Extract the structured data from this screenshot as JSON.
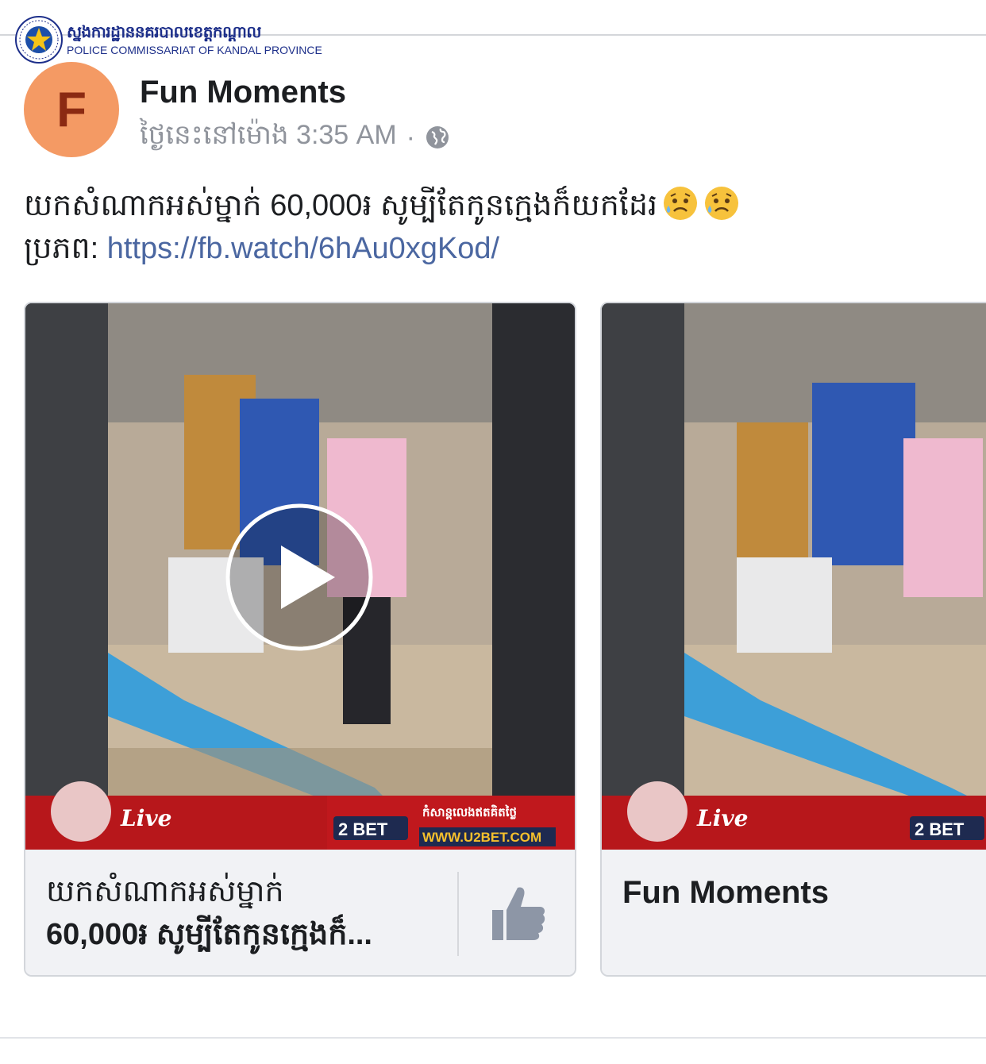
{
  "watermark": {
    "org_kh": "ស្នងការដ្ឋាននគរបាលខេត្តកណ្តាល",
    "org_en": "POLICE COMMISSARIAT OF KANDAL PROVINCE"
  },
  "post": {
    "avatar_letter": "F",
    "page_name": "Fun Moments",
    "time_text": "ថ្ងៃនេះនៅម៉ោង 3:35 AM",
    "separator": "·",
    "privacy_icon": "globe-icon",
    "body_line1": "យកសំណាកអស់ម្នាក់ 60,000៛ សូម្បីតែកូនក្មេងក៏យកដែរ",
    "emoji": [
      "sad-sweat-emoji",
      "sad-sweat-emoji"
    ],
    "source_label": "ប្រភព: ",
    "source_link": "https://fb.watch/6hAu0xgKod/"
  },
  "cards": [
    {
      "title_line1": "យកសំណាកអស់ម្នាក់",
      "title_line2": "60,000៛ សូម្បីតែកូនក្មេងក៏...",
      "action_icon": "thumbs-up-icon",
      "ad_brand": "2 BET",
      "ad_url": "WWW.U2BET.COM",
      "ad_live": "Live",
      "ad_tagline": "កំសាន្តលេងឥតគិតថ្លៃ"
    },
    {
      "title": "Fun Moments",
      "ad_brand": "2 BET",
      "ad_live": "Live"
    }
  ],
  "colors": {
    "avatar_bg": "#f49a64",
    "avatar_letter": "#8b2a12",
    "link": "#4b67a1",
    "meta": "#90949c"
  }
}
